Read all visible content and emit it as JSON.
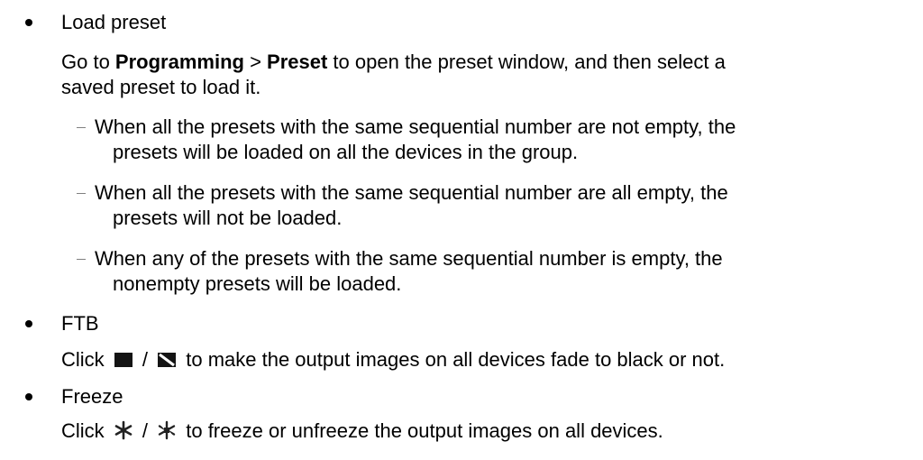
{
  "sections": [
    {
      "title": "Load preset",
      "instruction": {
        "prefix": "Go to ",
        "bold1": "Programming",
        "sep": " > ",
        "bold2": "Preset",
        "suffix": " to open the preset window, and then select a",
        "line2": "saved preset to load it."
      },
      "sub_items": [
        {
          "line1": "When all the presets with the same sequential number are not empty, the",
          "line2": "presets will be loaded on all the devices in the group."
        },
        {
          "line1": "When all the presets with the same sequential number are all empty, the",
          "line2": "presets will not be loaded."
        },
        {
          "line1": "When any of the presets with the same sequential number is empty, the",
          "line2": "nonempty presets will be loaded."
        }
      ]
    },
    {
      "title": "FTB",
      "instruction": {
        "prefix": "Click ",
        "slash": " / ",
        "suffix": " to make the output images on all devices fade to black or not."
      },
      "icons": [
        "ftb-on-icon",
        "ftb-off-icon"
      ]
    },
    {
      "title": "Freeze",
      "instruction": {
        "prefix": "Click ",
        "slash": " / ",
        "suffix": " to freeze or unfreeze the output images on all devices."
      },
      "icons": [
        "freeze-icon",
        "unfreeze-icon"
      ]
    }
  ]
}
